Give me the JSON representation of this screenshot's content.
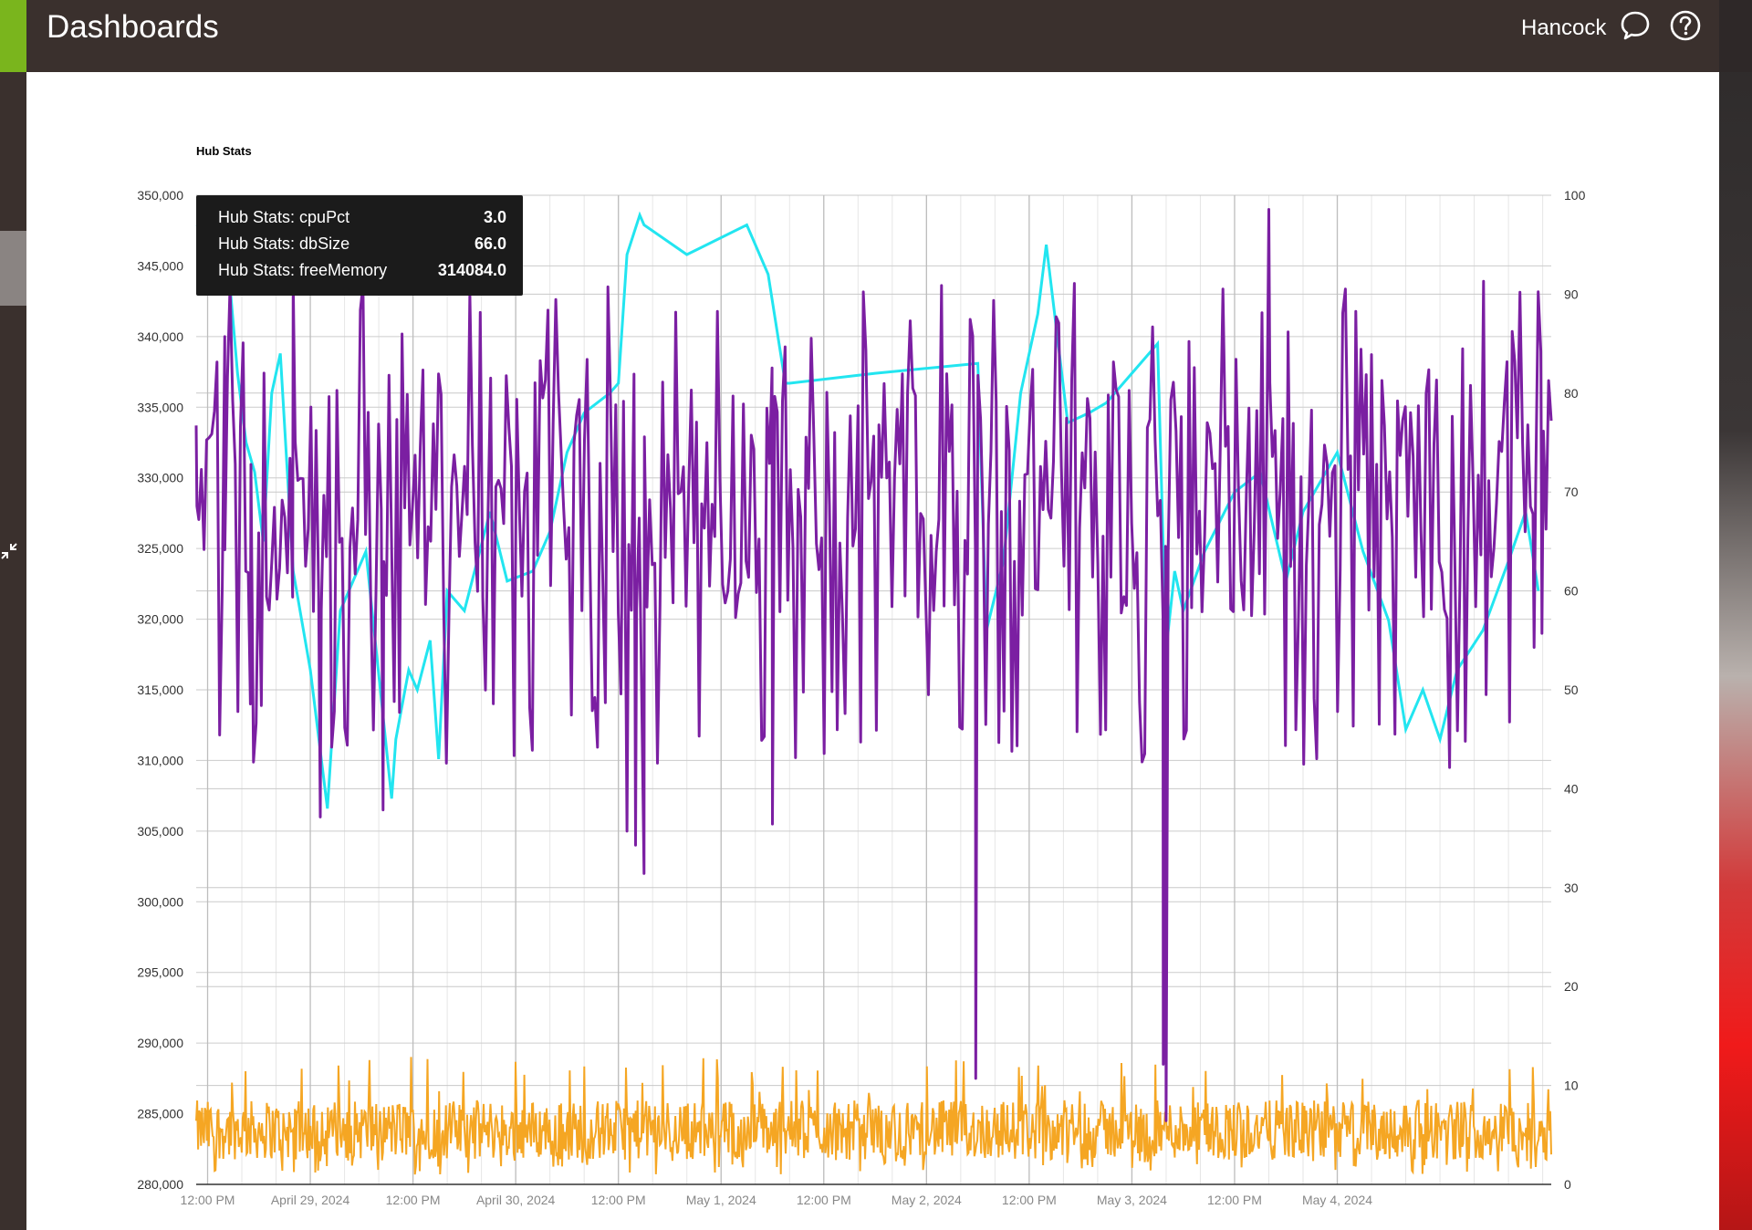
{
  "header": {
    "title": "Dashboards",
    "user": "Hancock",
    "chat_icon": "chat-bubble-icon",
    "help_icon": "help-circle-icon",
    "accent_color": "#7ab51d"
  },
  "sidebar": {
    "collapse_icon": "collapse-arrows-icon"
  },
  "tooltip": {
    "rows": [
      {
        "label": "Hub Stats: cpuPct",
        "value": "3.0"
      },
      {
        "label": "Hub Stats: dbSize",
        "value": "66.0"
      },
      {
        "label": "Hub Stats: freeMemory",
        "value": "314084.0"
      }
    ]
  },
  "chart_data": {
    "type": "line",
    "title": "Hub Stats",
    "xlabel": "",
    "ylabel_left": "",
    "ylabel_right": "",
    "y_left_range": [
      280000,
      350000
    ],
    "y_left_ticks": [
      "280,000",
      "285,000",
      "290,000",
      "295,000",
      "300,000",
      "305,000",
      "310,000",
      "315,000",
      "320,000",
      "325,000",
      "330,000",
      "335,000",
      "340,000",
      "345,000",
      "350,000"
    ],
    "y_right_range": [
      0,
      100
    ],
    "y_right_ticks": [
      "0",
      "10",
      "20",
      "30",
      "40",
      "50",
      "60",
      "70",
      "80",
      "90",
      "100"
    ],
    "x_range": [
      "2024-04-28T10:40",
      "2024-05-05T01:00"
    ],
    "x_ticks": [
      {
        "t": "2024-04-28T12:00",
        "label": "12:00 PM"
      },
      {
        "t": "2024-04-29T00:00",
        "label": "April 29, 2024"
      },
      {
        "t": "2024-04-29T12:00",
        "label": "12:00 PM"
      },
      {
        "t": "2024-04-30T00:00",
        "label": "April 30, 2024"
      },
      {
        "t": "2024-04-30T12:00",
        "label": "12:00 PM"
      },
      {
        "t": "2024-05-01T00:00",
        "label": "May 1, 2024"
      },
      {
        "t": "2024-05-01T12:00",
        "label": "12:00 PM"
      },
      {
        "t": "2024-05-02T00:00",
        "label": "May 2, 2024"
      },
      {
        "t": "2024-05-02T12:00",
        "label": "12:00 PM"
      },
      {
        "t": "2024-05-03T00:00",
        "label": "May 3, 2024"
      },
      {
        "t": "2024-05-03T12:00",
        "label": "12:00 PM"
      },
      {
        "t": "2024-05-04T00:00",
        "label": "May 4, 2024"
      }
    ],
    "grid": true,
    "series": [
      {
        "name": "Hub Stats: cpuPct",
        "axis": "right",
        "color": "#f5a623",
        "approx_mean": 5.5,
        "approx_min": 1,
        "approx_max": 13
      },
      {
        "name": "Hub Stats: dbSize",
        "axis": "right",
        "color": "#22e5f0",
        "points": [
          [
            "2024-04-28T10:45",
            97
          ],
          [
            "2024-04-28T14:30",
            92
          ],
          [
            "2024-04-28T15:30",
            82
          ],
          [
            "2024-04-28T16:30",
            75
          ],
          [
            "2024-04-28T17:30",
            72
          ],
          [
            "2024-04-28T18:30",
            65
          ],
          [
            "2024-04-28T19:30",
            80
          ],
          [
            "2024-04-28T20:30",
            84
          ],
          [
            "2024-04-28T22:00",
            62
          ],
          [
            "2024-04-29T00:00",
            52
          ],
          [
            "2024-04-29T02:00",
            38
          ],
          [
            "2024-04-29T03:30",
            58
          ],
          [
            "2024-04-29T04:30",
            60
          ],
          [
            "2024-04-29T06:30",
            64
          ],
          [
            "2024-04-29T09:30",
            39
          ],
          [
            "2024-04-29T10:00",
            45
          ],
          [
            "2024-04-29T11:30",
            52
          ],
          [
            "2024-04-29T12:30",
            50
          ],
          [
            "2024-04-29T14:00",
            55
          ],
          [
            "2024-04-29T15:00",
            43
          ],
          [
            "2024-04-29T16:00",
            60
          ],
          [
            "2024-04-29T18:00",
            58
          ],
          [
            "2024-04-29T19:30",
            63
          ],
          [
            "2024-04-29T21:00",
            68
          ],
          [
            "2024-04-29T23:00",
            61
          ],
          [
            "2024-04-30T02:00",
            62
          ],
          [
            "2024-04-30T04:00",
            66
          ],
          [
            "2024-04-30T06:00",
            74
          ],
          [
            "2024-04-30T08:00",
            78
          ],
          [
            "2024-04-30T11:00",
            80
          ],
          [
            "2024-04-30T12:00",
            81
          ],
          [
            "2024-04-30T13:00",
            94
          ],
          [
            "2024-04-30T14:30",
            98
          ],
          [
            "2024-04-30T15:00",
            97
          ],
          [
            "2024-04-30T20:00",
            94
          ],
          [
            "2024-05-01T03:00",
            97
          ],
          [
            "2024-05-01T05:30",
            92
          ],
          [
            "2024-05-01T07:30",
            81
          ],
          [
            "2024-05-01T08:00",
            81
          ],
          [
            "2024-05-01T18:00",
            82
          ],
          [
            "2024-05-02T06:00",
            83
          ],
          [
            "2024-05-02T07:00",
            56
          ],
          [
            "2024-05-02T09:00",
            63
          ],
          [
            "2024-05-02T11:00",
            80
          ],
          [
            "2024-05-02T13:00",
            88
          ],
          [
            "2024-05-02T14:00",
            95
          ],
          [
            "2024-05-02T16:30",
            77
          ],
          [
            "2024-05-02T19:00",
            78
          ],
          [
            "2024-05-02T21:00",
            79
          ],
          [
            "2024-05-03T00:00",
            82
          ],
          [
            "2024-05-03T03:00",
            85
          ],
          [
            "2024-05-03T04:00",
            54
          ],
          [
            "2024-05-03T05:00",
            62
          ],
          [
            "2024-05-03T06:00",
            58
          ],
          [
            "2024-05-03T08:30",
            64
          ],
          [
            "2024-05-03T12:00",
            70
          ],
          [
            "2024-05-03T15:00",
            72
          ],
          [
            "2024-05-03T18:00",
            61
          ],
          [
            "2024-05-03T20:00",
            68
          ],
          [
            "2024-05-04T00:00",
            74
          ],
          [
            "2024-05-04T03:00",
            64
          ],
          [
            "2024-05-04T06:00",
            57
          ],
          [
            "2024-05-04T08:00",
            46
          ],
          [
            "2024-05-04T10:00",
            50
          ],
          [
            "2024-05-04T12:00",
            45
          ],
          [
            "2024-05-04T14:00",
            52
          ],
          [
            "2024-05-04T17:00",
            56
          ],
          [
            "2024-05-04T20:00",
            63
          ],
          [
            "2024-05-04T22:00",
            68
          ],
          [
            "2024-05-04T23:30",
            60
          ]
        ]
      },
      {
        "name": "Hub Stats: freeMemory",
        "axis": "left",
        "color": "#7b1fa2",
        "approx_band": [
          320000,
          338000
        ],
        "points": [
          [
            "2024-04-28T10:45",
            328000
          ],
          [
            "2024-04-28T14:00",
            340000
          ],
          [
            "2024-04-28T17:00",
            314000
          ],
          [
            "2024-04-28T22:00",
            344000
          ],
          [
            "2024-04-29T01:10",
            306000
          ],
          [
            "2024-04-29T08:30",
            306500
          ],
          [
            "2024-04-30T13:00",
            305000
          ],
          [
            "2024-04-30T14:00",
            304000
          ],
          [
            "2024-04-30T15:00",
            302000
          ],
          [
            "2024-05-01T06:00",
            305500
          ],
          [
            "2024-05-02T05:45",
            287500
          ],
          [
            "2024-05-03T03:40",
            288500
          ],
          [
            "2024-05-03T04:00",
            284500
          ],
          [
            "2024-05-03T16:00",
            349000
          ],
          [
            "2024-05-04T23:00",
            318000
          ],
          [
            "2024-05-04T23:55",
            319000
          ]
        ]
      }
    ]
  }
}
